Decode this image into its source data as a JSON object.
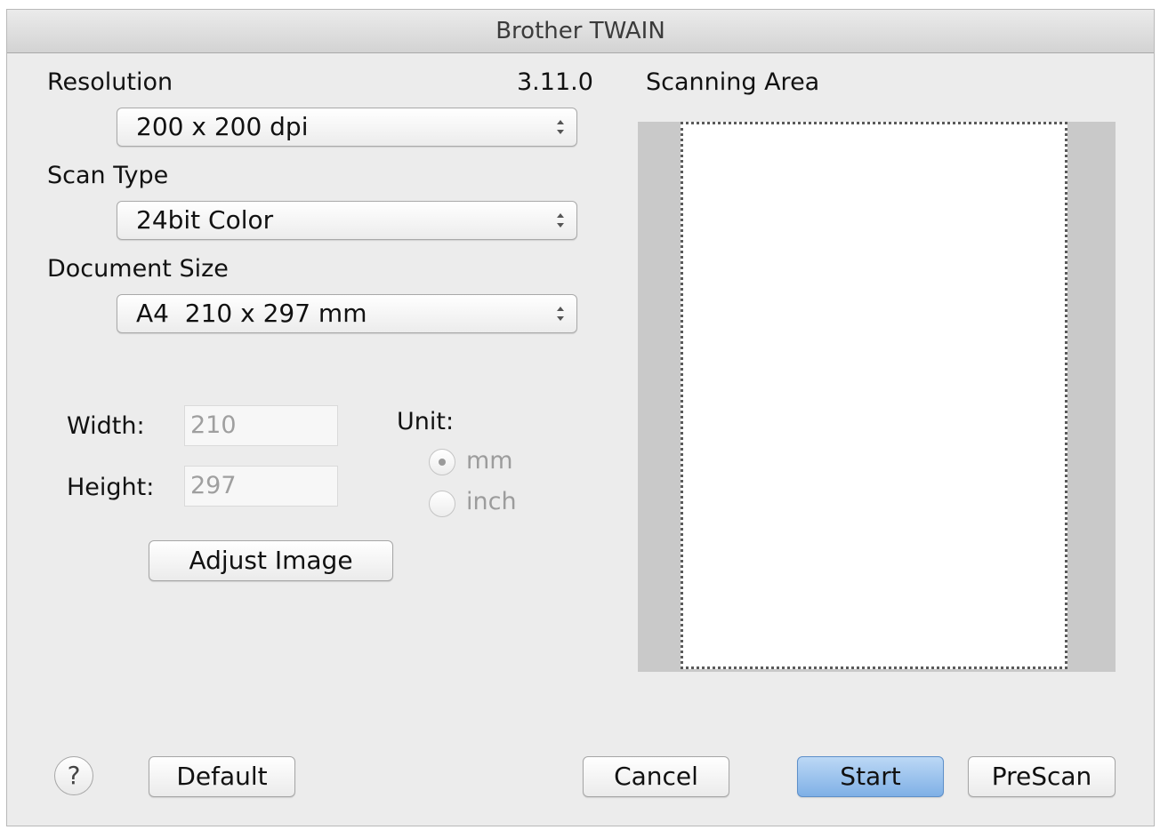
{
  "window": {
    "title": "Brother TWAIN"
  },
  "version": "3.11.0",
  "resolution": {
    "label": "Resolution",
    "value": "200 x 200 dpi"
  },
  "scan_type": {
    "label": "Scan Type",
    "value": "24bit Color"
  },
  "document_size": {
    "label": "Document Size",
    "value": "A4  210 x 297 mm"
  },
  "width": {
    "label": "Width:",
    "value": "210"
  },
  "height": {
    "label": "Height:",
    "value": "297"
  },
  "unit": {
    "label": "Unit:",
    "options": [
      {
        "label": "mm",
        "selected": true
      },
      {
        "label": "inch",
        "selected": false
      }
    ]
  },
  "buttons": {
    "adjust_image": "Adjust Image",
    "help": "?",
    "default": "Default",
    "cancel": "Cancel",
    "start": "Start",
    "prescan": "PreScan"
  },
  "scanning_area": {
    "label": "Scanning Area"
  },
  "colors": {
    "default_button": "#7fb0e6",
    "window_bg": "#ececec",
    "preview_margin": "#c9c9c9"
  }
}
